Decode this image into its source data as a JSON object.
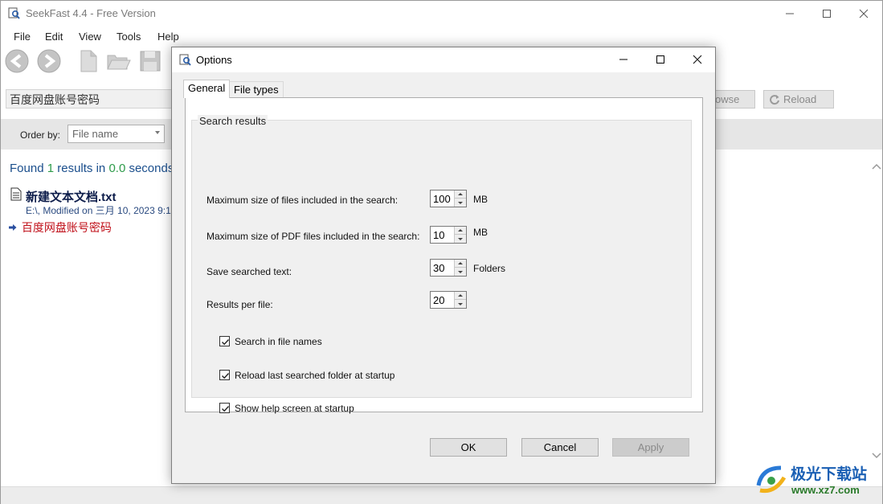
{
  "main_window": {
    "title": "SeekFast 4.4 - Free Version",
    "menu": [
      "File",
      "Edit",
      "View",
      "Tools",
      "Help"
    ],
    "search_value": "百度网盘账号密码",
    "browse_label": "owse",
    "reload_label": "Reload",
    "order_label": "Order by:",
    "order_value": "File name",
    "found": {
      "prefix": "Found",
      "count": "1",
      "mid": "results in",
      "seconds": "0.0",
      "suffix": "seconds."
    },
    "result": {
      "file_name": "新建文本文档.txt",
      "meta": "E:\\, Modified on 三月  10, 2023 9:1",
      "hit_text": "百度网盘账号密码"
    }
  },
  "dialog": {
    "title": "Options",
    "tabs": [
      "General",
      "File types"
    ],
    "active_tab": "General",
    "group_title": "Search results",
    "settings": [
      {
        "label": "Maximum size of files included in the search:",
        "value": "100",
        "unit": "MB"
      },
      {
        "label": "Maximum size of PDF files included in the search:",
        "value": "10",
        "unit": "MB"
      },
      {
        "label": "Save searched text:",
        "value": "30",
        "unit": "Folders"
      },
      {
        "label": "Results per file:",
        "value": "20",
        "unit": ""
      }
    ],
    "checkboxes": [
      {
        "label": "Search in file names",
        "checked": true
      },
      {
        "label": "Reload last searched folder at startup",
        "checked": true
      },
      {
        "label": "Show help screen at startup",
        "checked": true
      }
    ],
    "buttons": {
      "ok": "OK",
      "cancel": "Cancel",
      "apply": "Apply"
    }
  },
  "watermark": {
    "text": "极光下载站",
    "url": "www.xz7.com"
  },
  "colors": {
    "found_text": "#1a4e8c",
    "found_numbers": "#2e9b4a",
    "hit_text": "#c0101a",
    "file_title": "#0c1c4a"
  }
}
